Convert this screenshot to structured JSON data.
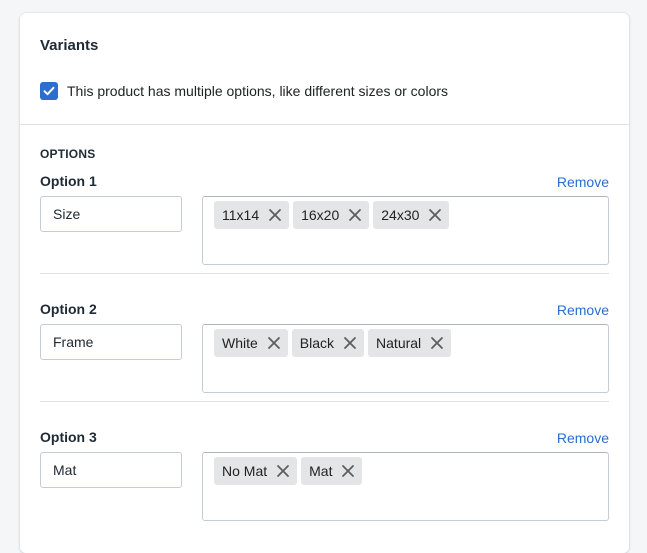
{
  "card": {
    "title": "Variants",
    "checkbox_label": "This product has multiple options, like different sizes or colors",
    "checkbox_checked": true
  },
  "options_heading": "OPTIONS",
  "remove_label": "Remove",
  "options": [
    {
      "label": "Option 1",
      "name": "Size",
      "values": [
        "11x14",
        "16x20",
        "24x30"
      ]
    },
    {
      "label": "Option 2",
      "name": "Frame",
      "values": [
        "White",
        "Black",
        "Natural"
      ]
    },
    {
      "label": "Option 3",
      "name": "Mat",
      "values": [
        "No Mat",
        "Mat"
      ]
    }
  ],
  "colors": {
    "accent": "#2c6ecb",
    "tag_bg": "#e4e5e7",
    "border": "#c4cdd5"
  },
  "icons": {
    "checkbox": "checkmark-icon",
    "tag_remove": "close-icon"
  }
}
